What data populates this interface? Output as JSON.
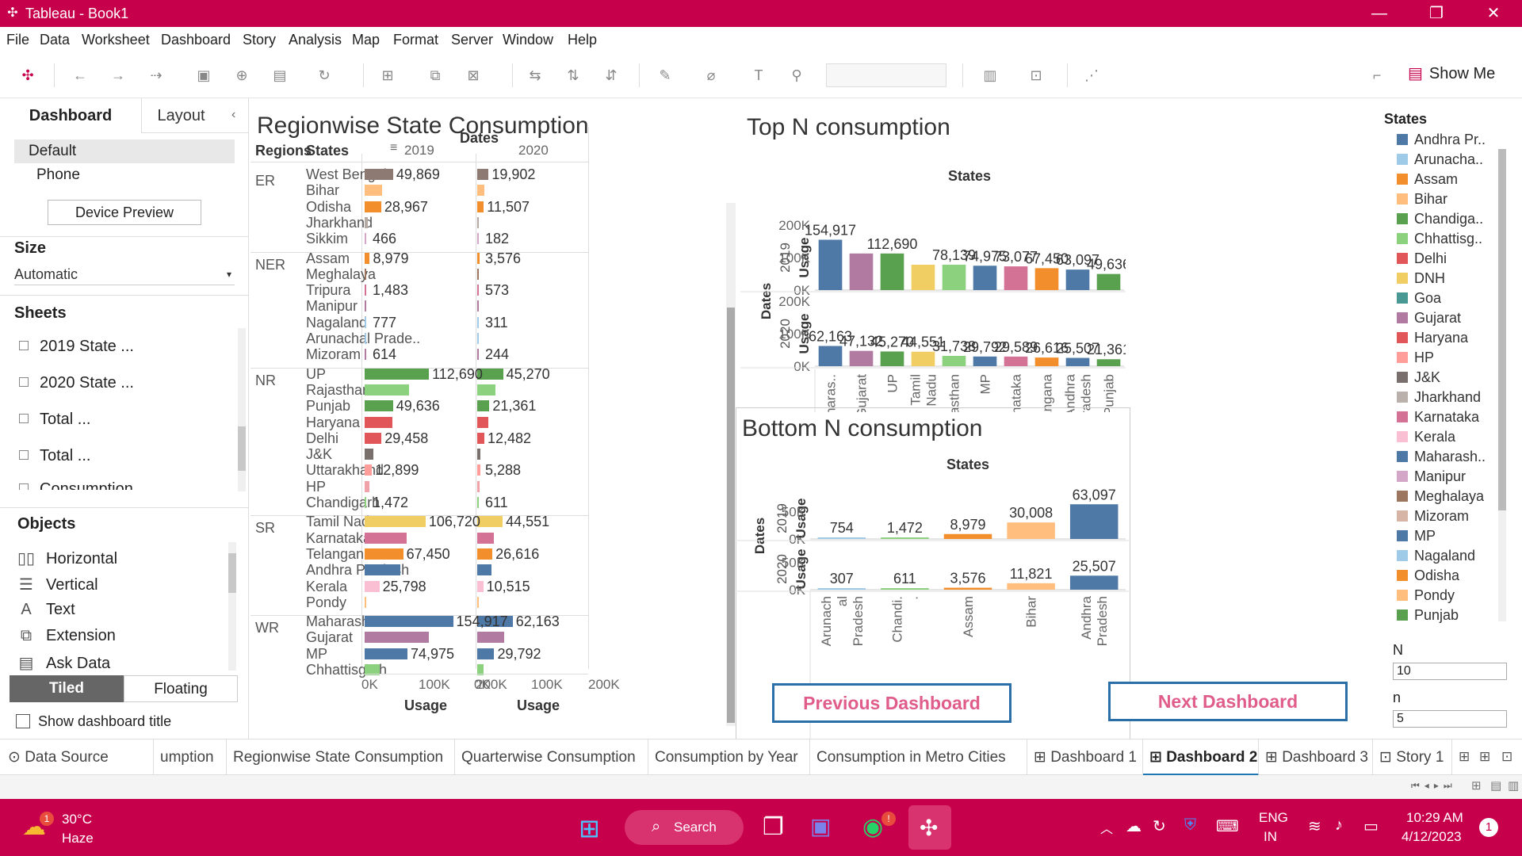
{
  "window": {
    "title": "Tableau - Book1",
    "min": "—",
    "max": "❐",
    "close": "✕"
  },
  "menu": [
    "File",
    "Data",
    "Worksheet",
    "Dashboard",
    "Story",
    "Analysis",
    "Map",
    "Format",
    "Server",
    "Window",
    "Help"
  ],
  "toolbar": {
    "show_me": "Show Me"
  },
  "left_pane": {
    "tab_dashboard": "Dashboard",
    "tab_layout": "Layout",
    "device_default": "Default",
    "device_phone": "Phone",
    "device_preview": "Device Preview",
    "size_label": "Size",
    "size_value": "Automatic",
    "sheets_label": "Sheets",
    "sheets": [
      "2019 State ...",
      "2020 State ...",
      "Total ...",
      "Total ...",
      "Consumption..."
    ],
    "objects_label": "Objects",
    "objects": [
      {
        "label": "Horizontal",
        "icon": "horizontal-container-icon",
        "glyph": "▯▯"
      },
      {
        "label": "Vertical",
        "icon": "vertical-container-icon",
        "glyph": "☰"
      },
      {
        "label": "Text",
        "icon": "text-icon",
        "glyph": "A"
      },
      {
        "label": "Extension",
        "icon": "extension-icon",
        "glyph": "⧉"
      },
      {
        "label": "Ask Data",
        "icon": "ask-data-icon",
        "glyph": "▤"
      }
    ],
    "tiled": "Tiled",
    "floating": "Floating",
    "show_title": "Show dashboard title"
  },
  "regionwise": {
    "title": "Regionwise State Consumption",
    "dates_header": "Dates",
    "regions_header": "Regions",
    "states_header": "States",
    "col_2019": "2019",
    "col_2020": "2020",
    "axis_ticks": [
      "0K",
      "100K",
      "200K"
    ],
    "axis_title": "Usage",
    "max": 200000,
    "regions": [
      {
        "name": "ER",
        "states": [
          "West Bengal",
          "Bihar",
          "Odisha",
          "Jharkhand",
          "Sikkim"
        ],
        "colors": [
          "#8c7a73",
          "#ffbe7d",
          "#f28e2b",
          "#b6aaa4",
          "#d4a6c8"
        ],
        "v2019": [
          49869,
          30008,
          28967,
          5000,
          466
        ],
        "v2020": [
          19902,
          11821,
          11507,
          2000,
          182
        ],
        "labels": [
          {
            "row": 0,
            "a": "49,869",
            "b": "19,902"
          },
          {
            "row": 2,
            "a": "28,967",
            "b": "11,507"
          },
          {
            "row": 4,
            "a": "466",
            "b": "182"
          }
        ]
      },
      {
        "name": "NER",
        "states": [
          "Assam",
          "Meghalaya",
          "Tripura",
          "Manipur",
          "Nagaland",
          "Arunachal Prade..",
          "Mizoram"
        ],
        "colors": [
          "#f28e2b",
          "#9d7660",
          "#d37295",
          "#b07aa1",
          "#a0cbe8",
          "#a0cbe8",
          "#b07aa1"
        ],
        "v2019": [
          8979,
          1200,
          1483,
          900,
          777,
          754,
          614
        ],
        "v2020": [
          3576,
          400,
          573,
          300,
          311,
          307,
          244
        ],
        "labels": [
          {
            "row": 0,
            "a": "8,979",
            "b": "3,576"
          },
          {
            "row": 2,
            "a": "1,483",
            "b": "573"
          },
          {
            "row": 4,
            "a": "777",
            "b": "311"
          },
          {
            "row": 6,
            "a": "614",
            "b": "244"
          }
        ]
      },
      {
        "name": "NR",
        "states": [
          "UP",
          "Rajasthan",
          "Punjab",
          "Haryana",
          "Delhi",
          "J&K",
          "Uttarakhand",
          "HP",
          "Chandigarh"
        ],
        "colors": [
          "#59a14f",
          "#8cd17d",
          "#59a14f",
          "#e15759",
          "#e15759",
          "#79706e",
          "#ff9d9a",
          "#f1a2a9",
          "#8cd17d"
        ],
        "v2019": [
          112690,
          78139,
          49636,
          48000,
          29458,
          15000,
          12899,
          9000,
          1472
        ],
        "v2020": [
          45270,
          31738,
          21361,
          19000,
          12482,
          6000,
          5288,
          3500,
          611
        ],
        "labels": [
          {
            "row": 0,
            "a": "112,690",
            "b": "45,270"
          },
          {
            "row": 2,
            "a": "49,636",
            "b": "21,361"
          },
          {
            "row": 4,
            "a": "29,458",
            "b": "12,482"
          },
          {
            "row": 6,
            "a": "12,899",
            "b": "5,288"
          },
          {
            "row": 8,
            "a": "1,472",
            "b": "611"
          }
        ]
      },
      {
        "name": "SR",
        "states": [
          "Tamil Nadu",
          "Karnataka",
          "Telangana",
          "Andhra Pradesh",
          "Kerala",
          "Pondy"
        ],
        "colors": [
          "#f1ce63",
          "#d37295",
          "#f28e2b",
          "#4e79a7",
          "#fabfd2",
          "#ffbe7d"
        ],
        "v2019": [
          106720,
          73077,
          67450,
          63097,
          25798,
          2500
        ],
        "v2020": [
          44551,
          29589,
          26616,
          25507,
          10515,
          1000
        ],
        "labels": [
          {
            "row": 0,
            "a": "106,720",
            "b": "44,551"
          },
          {
            "row": 2,
            "a": "67,450",
            "b": "26,616"
          },
          {
            "row": 4,
            "a": "25,798",
            "b": "10,515"
          }
        ]
      },
      {
        "name": "WR",
        "states": [
          "Maharashtra",
          "Gujarat",
          "MP",
          "Chhattisgarh"
        ],
        "colors": [
          "#4e79a7",
          "#b07aa1",
          "#4e79a7",
          "#8cd17d"
        ],
        "v2019": [
          154917,
          112000,
          74975,
          26000
        ],
        "v2020": [
          62163,
          47132,
          29792,
          11000
        ],
        "labels": [
          {
            "row": 0,
            "a": "154,917",
            "b": "62,163"
          },
          {
            "row": 2,
            "a": "74,975",
            "b": "29,792"
          }
        ]
      }
    ]
  },
  "chart_data": [
    {
      "type": "bar",
      "title": "Top N consumption",
      "xlabel": "States",
      "ylabel": "Usage",
      "row_label": "Dates",
      "categories": [
        "Maharas..",
        "Gujarat",
        "UP",
        "Tamil Nadu",
        "Rajasthan",
        "MP",
        "Karnataka",
        "Telangana",
        "Andhra Pradesh",
        "Punjab"
      ],
      "colors": [
        "#4e79a7",
        "#b07aa1",
        "#59a14f",
        "#f1ce63",
        "#8cd17d",
        "#4e79a7",
        "#d37295",
        "#f28e2b",
        "#4e79a7",
        "#59a14f"
      ],
      "ylim": [
        0,
        200000
      ],
      "y_ticks": [
        "200K",
        "100K",
        "0K"
      ],
      "series": [
        {
          "name": "2019",
          "values": [
            154917,
            112690,
            112690,
            78139,
            78139,
            74975,
            73077,
            67450,
            63097,
            49636
          ],
          "labels": [
            "154,917",
            "",
            "112,690",
            "",
            "78,139",
            "74,975",
            "73,077",
            "67,450",
            "63,097",
            "49,636"
          ]
        },
        {
          "name": "2020",
          "values": [
            62163,
            47132,
            45270,
            44551,
            31738,
            29792,
            29589,
            26616,
            25507,
            21361
          ],
          "labels": [
            "62,163",
            "47,132",
            "45,270",
            "44,551",
            "31,738",
            "29,792",
            "29,589",
            "26,616",
            "25,507",
            "21,361"
          ]
        }
      ]
    },
    {
      "type": "bar",
      "title": "Bottom N consumption",
      "xlabel": "States",
      "ylabel": "Usage",
      "row_label": "Dates",
      "categories": [
        "Arunachal Pradesh",
        "Chandi..",
        "Assam",
        "Bihar",
        "Andhra Pradesh"
      ],
      "colors": [
        "#a0cbe8",
        "#8cd17d",
        "#f28e2b",
        "#ffbe7d",
        "#4e79a7"
      ],
      "ylim": [
        0,
        75000
      ],
      "y_ticks": [
        "50K",
        "0K"
      ],
      "series": [
        {
          "name": "2019",
          "values": [
            754,
            1472,
            8979,
            30008,
            63097
          ],
          "labels": [
            "754",
            "1,472",
            "8,979",
            "30,008",
            "63,097"
          ]
        },
        {
          "name": "2020",
          "values": [
            307,
            611,
            3576,
            11821,
            25507
          ],
          "labels": [
            "307",
            "611",
            "3,576",
            "11,821",
            "25,507"
          ]
        }
      ]
    }
  ],
  "legend": {
    "title": "States",
    "items": [
      {
        "label": "Andhra Pr..",
        "color": "#4e79a7"
      },
      {
        "label": "Arunacha..",
        "color": "#a0cbe8"
      },
      {
        "label": "Assam",
        "color": "#f28e2b"
      },
      {
        "label": "Bihar",
        "color": "#ffbe7d"
      },
      {
        "label": "Chandiga..",
        "color": "#59a14f"
      },
      {
        "label": "Chhattisg..",
        "color": "#8cd17d"
      },
      {
        "label": "Delhi",
        "color": "#e15759"
      },
      {
        "label": "DNH",
        "color": "#f1ce63"
      },
      {
        "label": "Goa",
        "color": "#499894"
      },
      {
        "label": "Gujarat",
        "color": "#b07aa1"
      },
      {
        "label": "Haryana",
        "color": "#e15759"
      },
      {
        "label": "HP",
        "color": "#ff9d9a"
      },
      {
        "label": "J&K",
        "color": "#79706e"
      },
      {
        "label": "Jharkhand",
        "color": "#bab0ac"
      },
      {
        "label": "Karnataka",
        "color": "#d37295"
      },
      {
        "label": "Kerala",
        "color": "#fabfd2"
      },
      {
        "label": "Maharash..",
        "color": "#4e79a7"
      },
      {
        "label": "Manipur",
        "color": "#d4a6c8"
      },
      {
        "label": "Meghalaya",
        "color": "#9d7660"
      },
      {
        "label": "Mizoram",
        "color": "#d7b5a6"
      },
      {
        "label": "MP",
        "color": "#4e79a7"
      },
      {
        "label": "Nagaland",
        "color": "#a0cbe8"
      },
      {
        "label": "Odisha",
        "color": "#f28e2b"
      },
      {
        "label": "Pondy",
        "color": "#ffbe7d"
      },
      {
        "label": "Punjab",
        "color": "#59a14f"
      }
    ]
  },
  "params": {
    "n_label": "N",
    "n_value": "10",
    "n2_label": "n",
    "n2_value": "5"
  },
  "nav": {
    "previous": "Previous Dashboard",
    "next": "Next Dashboard"
  },
  "sheet_tabs": [
    {
      "label": "⊙ Data Source"
    },
    {
      "label": "umption"
    },
    {
      "label": "Regionwise State Consumption"
    },
    {
      "label": "Quarterwise Consumption"
    },
    {
      "label": "Consumption by Year"
    },
    {
      "label": "Consumption in Metro Cities"
    },
    {
      "label": "⊞ Dashboard 1"
    },
    {
      "label": "⊞ Dashboard 2",
      "active": true
    },
    {
      "label": "⊞ Dashboard 3"
    },
    {
      "label": "⊡ Story 1"
    }
  ],
  "taskbar": {
    "weather_temp": "30°C",
    "weather_desc": "Haze",
    "search": "Search",
    "lang1": "ENG",
    "lang2": "IN",
    "time": "10:29 AM",
    "date": "4/12/2023",
    "notif": "1",
    "weather_badge": "1",
    "chat_badge": "!"
  }
}
